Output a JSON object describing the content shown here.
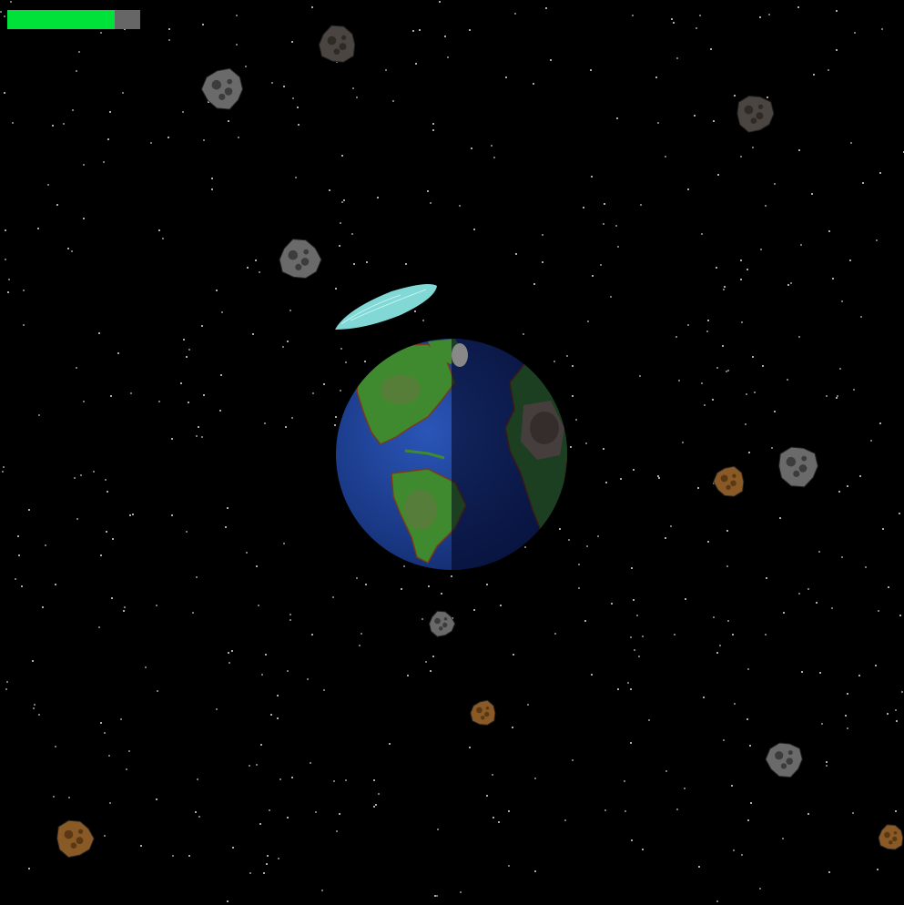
{
  "hud": {
    "health_fraction": 0.81,
    "health_color": "#00e23a",
    "health_track_color": "#666666"
  },
  "player": {
    "name": "shield-paddle",
    "color": "#8ff0ec"
  },
  "planet": {
    "name": "earth",
    "ocean_color": "#1a3a8c",
    "land_color": "#3f8a2e",
    "night_side": true
  },
  "asteroids": [
    {
      "kind": "rock-dark"
    },
    {
      "kind": "rock-gray"
    },
    {
      "kind": "rock-dark"
    },
    {
      "kind": "rock-gray"
    },
    {
      "kind": "rock-brown"
    },
    {
      "kind": "rock-gray"
    },
    {
      "kind": "rock-gray"
    },
    {
      "kind": "rock-brown"
    },
    {
      "kind": "rock-gray"
    },
    {
      "kind": "rock-brown"
    },
    {
      "kind": "rock-brown"
    },
    {
      "kind": "rock-gray"
    }
  ]
}
